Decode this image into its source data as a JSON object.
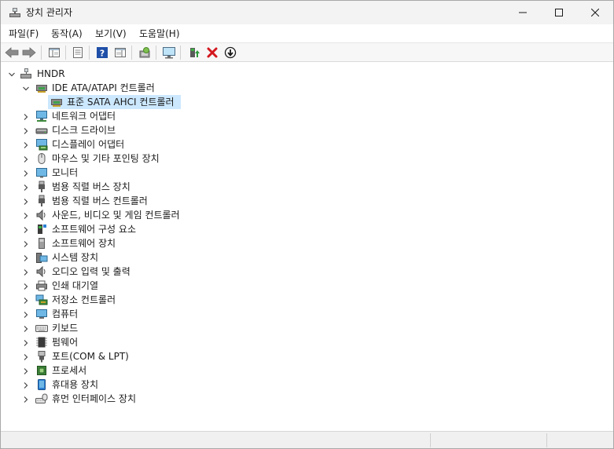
{
  "window": {
    "title": "장치 관리자"
  },
  "menu": {
    "items": [
      {
        "label": "파일(F)"
      },
      {
        "label": "동작(A)"
      },
      {
        "label": "보기(V)"
      },
      {
        "label": "도움말(H)"
      }
    ]
  },
  "toolbar": {
    "buttons": [
      {
        "icon": "back-arrow-icon"
      },
      {
        "icon": "forward-arrow-icon"
      },
      {
        "icon": "show-hide-console-tree-icon"
      },
      {
        "icon": "properties-icon"
      },
      {
        "icon": "help-icon"
      },
      {
        "icon": "show-action-pane-icon"
      },
      {
        "icon": "scan-hardware-changes-icon"
      },
      {
        "icon": "monitor-icon"
      },
      {
        "icon": "update-driver-icon"
      },
      {
        "icon": "uninstall-device-icon"
      },
      {
        "icon": "disable-device-icon"
      }
    ]
  },
  "tree": {
    "root": {
      "label": "HNDR",
      "icon": "computer-root-icon"
    },
    "ide": {
      "label": "IDE ATA/ATAPI 컨트롤러",
      "icon": "ide-controller-icon"
    },
    "ide_child": {
      "label": "표준 SATA AHCI 컨트롤러",
      "icon": "ide-controller-icon"
    },
    "categories": [
      {
        "label": "네트워크 어댑터",
        "icon": "network-adapter-icon"
      },
      {
        "label": "디스크 드라이브",
        "icon": "disk-drive-icon"
      },
      {
        "label": "디스플레이 어댑터",
        "icon": "display-adapter-icon"
      },
      {
        "label": "마우스 및 기타 포인팅 장치",
        "icon": "mouse-icon"
      },
      {
        "label": "모니터",
        "icon": "monitor-icon"
      },
      {
        "label": "범용 직렬 버스 장치",
        "icon": "usb-device-icon"
      },
      {
        "label": "범용 직렬 버스 컨트롤러",
        "icon": "usb-controller-icon"
      },
      {
        "label": "사운드, 비디오 및 게임 컨트롤러",
        "icon": "sound-icon"
      },
      {
        "label": "소프트웨어 구성 요소",
        "icon": "software-component-icon"
      },
      {
        "label": "소프트웨어 장치",
        "icon": "software-device-icon"
      },
      {
        "label": "시스템 장치",
        "icon": "system-device-icon"
      },
      {
        "label": "오디오 입력 및 출력",
        "icon": "audio-io-icon"
      },
      {
        "label": "인쇄 대기열",
        "icon": "print-queue-icon"
      },
      {
        "label": "저장소 컨트롤러",
        "icon": "storage-controller-icon"
      },
      {
        "label": "컴퓨터",
        "icon": "computer-icon"
      },
      {
        "label": "키보드",
        "icon": "keyboard-icon"
      },
      {
        "label": "펌웨어",
        "icon": "firmware-icon"
      },
      {
        "label": "포트(COM & LPT)",
        "icon": "port-icon"
      },
      {
        "label": "프로세서",
        "icon": "processor-icon"
      },
      {
        "label": "휴대용 장치",
        "icon": "portable-device-icon"
      },
      {
        "label": "휴먼 인터페이스 장치",
        "icon": "hid-icon"
      }
    ]
  },
  "colors": {
    "selection": "#cce8ff",
    "accent": "#0067c0",
    "delete_red": "#d4181f"
  }
}
